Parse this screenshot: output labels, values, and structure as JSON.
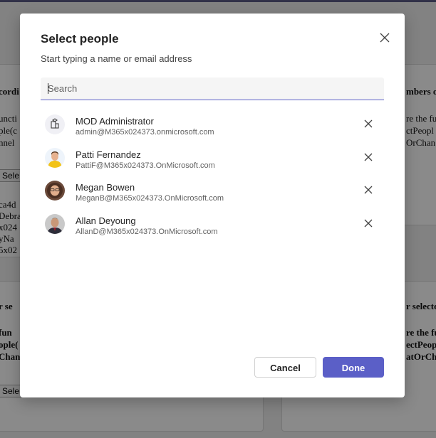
{
  "background": {
    "left_heading": "cordi",
    "left_lines": [
      "uncti",
      "ple(c",
      "nnel"
    ],
    "left_select": "Sele",
    "left_lines2": [
      "ca4d",
      "Debra",
      "x024",
      "yNa",
      "5x02"
    ],
    "left_heading2": "r se",
    "left_lines3": [
      "fun",
      "ople(",
      "Chan"
    ],
    "left_select2": "Sele",
    "right_heading": "mbers o",
    "right_lines": [
      "re the fu",
      "ctPeopl",
      "OrChan"
    ],
    "right_heading2": "r selecte",
    "right_lines2": [
      "re the fu",
      "ectPeop",
      "atOrCh"
    ]
  },
  "dialog": {
    "title": "Select people",
    "subtitle": "Start typing a name or email address",
    "search_placeholder": "Search",
    "close_icon": "close-icon",
    "people": [
      {
        "name": "MOD Administrator",
        "email": "admin@M365x024373.onmicrosoft.com",
        "avatar": "org-icon"
      },
      {
        "name": "Patti Fernandez",
        "email": "PattiF@M365x024373.OnMicrosoft.com",
        "avatar": "photo"
      },
      {
        "name": "Megan Bowen",
        "email": "MeganB@M365x024373.OnMicrosoft.com",
        "avatar": "photo"
      },
      {
        "name": "Allan Deyoung",
        "email": "AllanD@M365x024373.OnMicrosoft.com",
        "avatar": "photo"
      }
    ],
    "cancel_label": "Cancel",
    "done_label": "Done"
  },
  "colors": {
    "accent": "#5b5fc7",
    "overlay": "rgba(0,0,0,0.46)"
  }
}
